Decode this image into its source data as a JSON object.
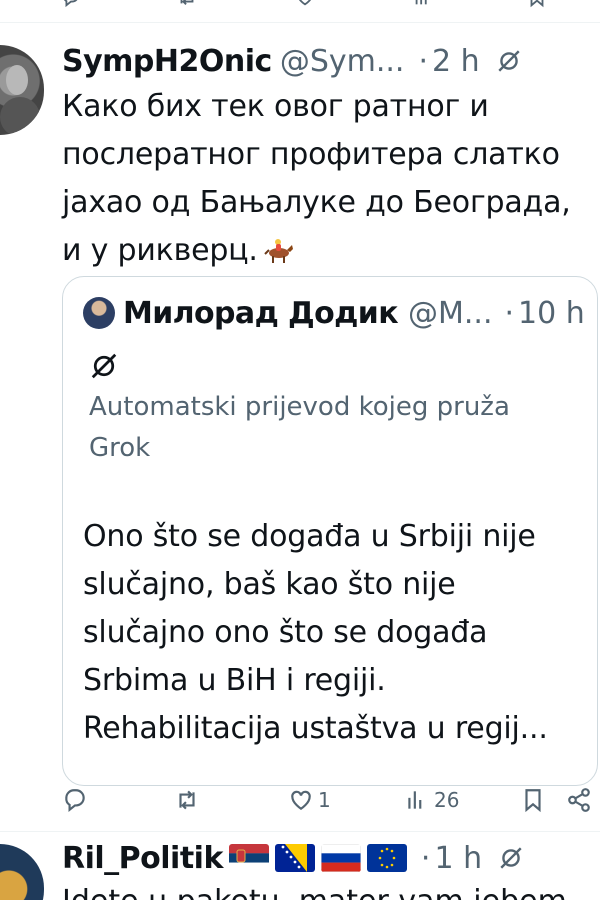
{
  "tweet": {
    "author_name": "SympH2Onic",
    "author_handle": "@Sym...",
    "separator": "·",
    "time": "2 h",
    "text_lines": [
      "Како бих тек овог ратног и",
      "послератног профитера слатко",
      "јахао од Бањалуке до Београда,",
      "и у рикверц."
    ],
    "emoji": "horse-racing-emoji",
    "quote": {
      "author_name": "Милорад Додик",
      "author_handle": "@M...",
      "separator": "·",
      "time": "10 h",
      "translation_note_lines": [
        "Automatski prijevod kojeg pruža",
        "Grok"
      ],
      "text_lines": [
        "Ono što se događa u Srbiji nije",
        "slučajno, baš kao što nije",
        "slučajno ono što se događa",
        "Srbima u BiH i regiji.",
        "Rehabilitacija ustaštva u regij..."
      ]
    },
    "actions": {
      "reply_count": "",
      "retweet_count": "",
      "like_count": "1",
      "views_count": "26"
    }
  },
  "next_tweet": {
    "author_name": "Ril_Politik",
    "separator": "·",
    "time": "1 h",
    "flags": [
      "serbia-flag",
      "bosnia-flag",
      "russia-flag",
      "eu-flag"
    ],
    "text_partial": "Idete u paketu, mater vam jebem"
  },
  "colors": {
    "text": "#0f1419",
    "secondary": "#536471",
    "border": "#cfd9de"
  }
}
